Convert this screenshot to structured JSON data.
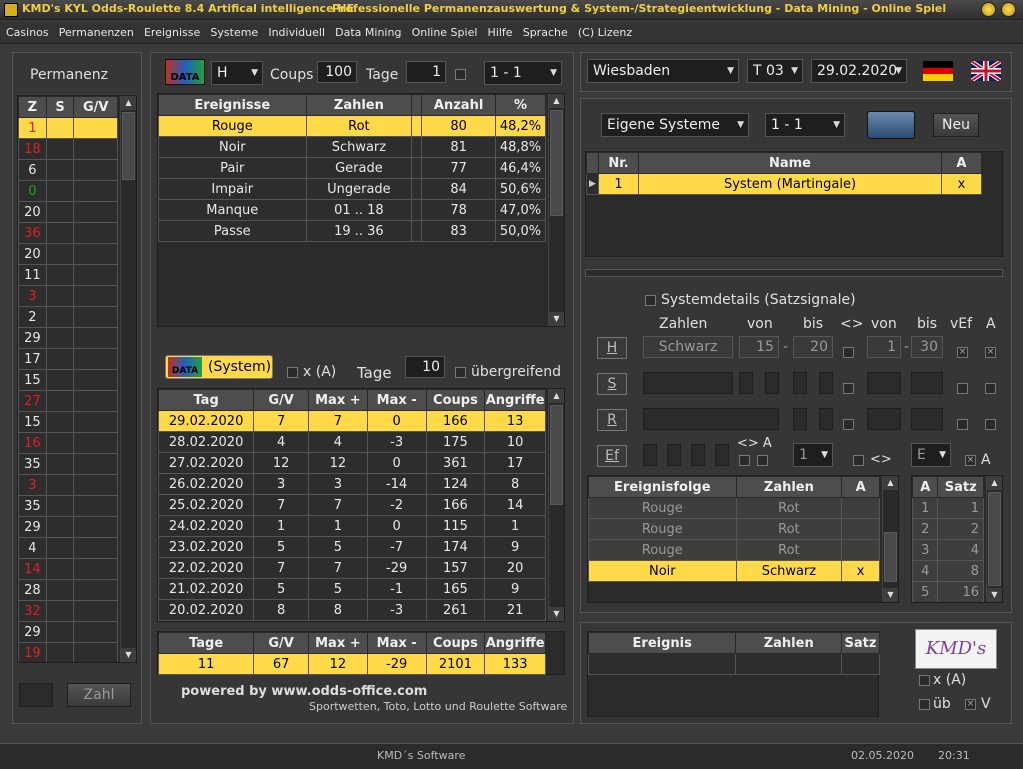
{
  "window": {
    "title_left": "KMD's KYL Odds-Roulette 8.4 Artifical intelligence HE",
    "title_right": "Professionelle Permanenzauswertung & System-/Strategieentwicklung - Data Mining - Online Spiel"
  },
  "menu": [
    "Casinos",
    "Permanenzen",
    "Ereignisse",
    "Systeme",
    "Individuell",
    "Data Mining",
    "Online Spiel",
    "Hilfe",
    "Sprache",
    "(C) Lizenz"
  ],
  "permanenz": {
    "title": "Permanenz",
    "headers": [
      "Z",
      "S",
      "G/V"
    ],
    "rows": [
      {
        "z": "1",
        "color": "red"
      },
      {
        "z": "18",
        "color": "red"
      },
      {
        "z": "6",
        "color": "black"
      },
      {
        "z": "0",
        "color": "green"
      },
      {
        "z": "20",
        "color": "black"
      },
      {
        "z": "36",
        "color": "red"
      },
      {
        "z": "20",
        "color": "black"
      },
      {
        "z": "11",
        "color": "black"
      },
      {
        "z": "3",
        "color": "red"
      },
      {
        "z": "2",
        "color": "black"
      },
      {
        "z": "29",
        "color": "black"
      },
      {
        "z": "17",
        "color": "black"
      },
      {
        "z": "15",
        "color": "black"
      },
      {
        "z": "27",
        "color": "red"
      },
      {
        "z": "15",
        "color": "black"
      },
      {
        "z": "16",
        "color": "red"
      },
      {
        "z": "35",
        "color": "black"
      },
      {
        "z": "3",
        "color": "red"
      },
      {
        "z": "35",
        "color": "black"
      },
      {
        "z": "29",
        "color": "black"
      },
      {
        "z": "4",
        "color": "black"
      },
      {
        "z": "14",
        "color": "red"
      },
      {
        "z": "28",
        "color": "black"
      },
      {
        "z": "32",
        "color": "red"
      },
      {
        "z": "29",
        "color": "black"
      },
      {
        "z": "19",
        "color": "red"
      }
    ],
    "zahl_button": "Zahl"
  },
  "top_controls": {
    "data_icon_label": "DATA",
    "mode": "H",
    "coups_label": "Coups",
    "coups": "100",
    "tage_label": "Tage",
    "tage": "1",
    "ratio": "1 - 1"
  },
  "events": {
    "headers": [
      "Ereignisse",
      "Zahlen",
      "",
      "Anzahl",
      "%"
    ],
    "rows": [
      {
        "e": "Rouge",
        "z": "Rot",
        "n": "80",
        "p": "48,2%"
      },
      {
        "e": "Noir",
        "z": "Schwarz",
        "n": "81",
        "p": "48,8%"
      },
      {
        "e": "Pair",
        "z": "Gerade",
        "n": "77",
        "p": "46,4%"
      },
      {
        "e": "Impair",
        "z": "Ungerade",
        "n": "84",
        "p": "50,6%"
      },
      {
        "e": "Manque",
        "z": "01 .. 18",
        "n": "78",
        "p": "47,0%"
      },
      {
        "e": "Passe",
        "z": "19 .. 36",
        "n": "83",
        "p": "50,0%"
      }
    ]
  },
  "system_bar": {
    "system_button": "(System)",
    "xa_label": "x (A)",
    "tage_label": "Tage",
    "tage": "10",
    "uebergreifend_label": "übergreifend"
  },
  "days": {
    "headers": [
      "Tag",
      "G/V",
      "Max +",
      "Max -",
      "Coups",
      "Angriffe"
    ],
    "rows": [
      [
        "29.02.2020",
        "7",
        "7",
        "0",
        "166",
        "13"
      ],
      [
        "28.02.2020",
        "4",
        "4",
        "-3",
        "175",
        "10"
      ],
      [
        "27.02.2020",
        "12",
        "12",
        "0",
        "361",
        "17"
      ],
      [
        "26.02.2020",
        "3",
        "3",
        "-14",
        "124",
        "8"
      ],
      [
        "25.02.2020",
        "7",
        "7",
        "-2",
        "166",
        "14"
      ],
      [
        "24.02.2020",
        "1",
        "1",
        "0",
        "115",
        "1"
      ],
      [
        "23.02.2020",
        "5",
        "5",
        "-7",
        "174",
        "9"
      ],
      [
        "22.02.2020",
        "7",
        "7",
        "-29",
        "157",
        "20"
      ],
      [
        "21.02.2020",
        "5",
        "5",
        "-1",
        "165",
        "9"
      ],
      [
        "20.02.2020",
        "8",
        "8",
        "-3",
        "261",
        "21"
      ]
    ]
  },
  "summary": {
    "headers": [
      "Tage",
      "G/V",
      "Max +",
      "Max -",
      "Coups",
      "Angriffe"
    ],
    "values": [
      "11",
      "67",
      "12",
      "-29",
      "2101",
      "133"
    ]
  },
  "footer": {
    "powered": "powered by www.odds-office.com",
    "tagline": "Sportwetten, Toto, Lotto und Roulette Software"
  },
  "casino": {
    "name": "Wiesbaden",
    "table": "T 03",
    "date": "29.02.2020"
  },
  "systems": {
    "dropdown": "Eigene Systeme",
    "ratio": "1 - 1",
    "new_button": "Neu",
    "headers": [
      "Nr.",
      "Name",
      "A"
    ],
    "rows": [
      {
        "nr": "1",
        "name": "System (Martingale)",
        "a": "x"
      }
    ]
  },
  "details": {
    "title": "Systemdetails  (Satzsignale)",
    "col_zahlen": "Zahlen",
    "col_von": "von",
    "col_bis": "bis",
    "col_neq": "<>",
    "col_von2": "von",
    "col_bis2": "bis",
    "col_vef": "vEf",
    "col_a": "A",
    "h_label": "H",
    "s_label": "S",
    "r_label": "R",
    "ef_label": "Ef",
    "h_zahlen": "Schwarz",
    "h_von": "15",
    "h_bis": "20",
    "h_von2": "1",
    "h_bis2": "30",
    "ef_neq_a": "<> A",
    "ef_dd": "1",
    "ef_neq": "<>",
    "ef_e": "E",
    "ef_a": "A"
  },
  "ereignisfolge": {
    "headers": [
      "Ereignisfolge",
      "Zahlen",
      "A"
    ],
    "rows": [
      {
        "e": "Rouge",
        "z": "Rot",
        "a": ""
      },
      {
        "e": "Rouge",
        "z": "Rot",
        "a": ""
      },
      {
        "e": "Rouge",
        "z": "Rot",
        "a": ""
      },
      {
        "e": "Noir",
        "z": "Schwarz",
        "a": "x"
      }
    ]
  },
  "satz": {
    "headers": [
      "A",
      "Satz"
    ],
    "rows": [
      [
        "1",
        "1"
      ],
      [
        "2",
        "2"
      ],
      [
        "3",
        "4"
      ],
      [
        "4",
        "8"
      ],
      [
        "5",
        "16"
      ]
    ]
  },
  "bottom_right": {
    "headers": [
      "Ereignis",
      "Zahlen",
      "Satz"
    ],
    "logo_text": "KMD's",
    "xa_label": "x (A)",
    "ueb_label": "üb",
    "v_label": "V"
  },
  "status": {
    "company": "KMD´s Software",
    "date": "02.05.2020",
    "time": "20:31"
  }
}
